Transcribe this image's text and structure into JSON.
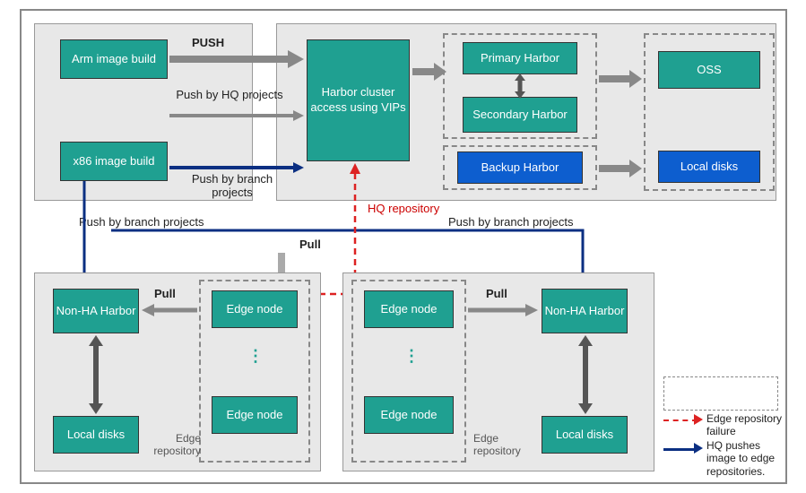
{
  "nodes": {
    "arm_build": "Arm image build",
    "x86_build": "x86 image build",
    "harbor_vip": "Harbor cluster access using VIPs",
    "primary_harbor": "Primary Harbor",
    "secondary_harbor": "Secondary Harbor",
    "backup_harbor": "Backup Harbor",
    "oss": "OSS",
    "local_disks_top": "Local disks",
    "nonha_left": "Non-HA Harbor",
    "local_disks_left": "Local disks",
    "edge_node_tl": "Edge node",
    "edge_node_bl": "Edge node",
    "edge_node_tr": "Edge node",
    "edge_node_br": "Edge node",
    "nonha_right": "Non-HA Harbor",
    "local_disks_right": "Local disks"
  },
  "labels": {
    "push_top": "PUSH",
    "push_hq": "Push by HQ projects",
    "push_branch": "Push by branch projects",
    "hq_repo": "HQ repository",
    "push_branch_left": "Push by branch projects",
    "push_branch_right": "Push by branch projects",
    "pull_top": "Pull",
    "pull_left": "Pull",
    "pull_right": "Pull",
    "edge_repo_left": "Edge repository",
    "edge_repo_right": "Edge repository"
  },
  "legend": {
    "fail": "Edge repository failure",
    "push": "HQ pushes image to edge repositories."
  }
}
